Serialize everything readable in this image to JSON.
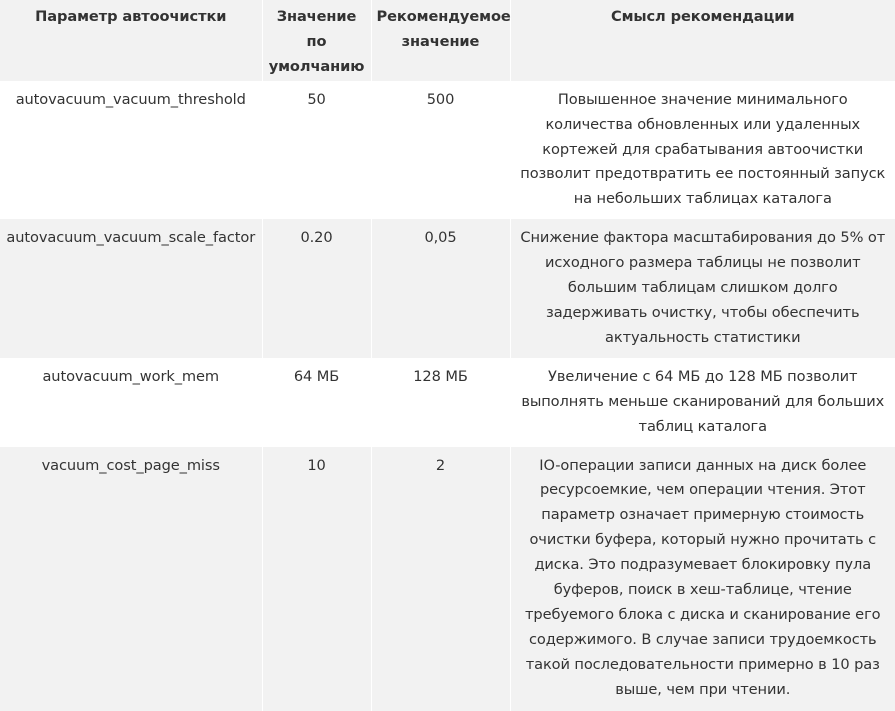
{
  "table": {
    "headers": [
      "Параметр автоочистки",
      "Значение по умолчанию",
      "Рекомендуемое значение",
      "Смысл рекомендации"
    ],
    "rows": [
      {
        "param": "autovacuum_vacuum_threshold",
        "default": "50",
        "recommended": "500",
        "meaning": "Повышенное значение минимального количества обновленных или удаленных кортежей для срабатывания автоочистки позволит предотвратить ее постоянный запуск на небольших таблицах каталога"
      },
      {
        "param": "autovacuum_vacuum_scale_factor",
        "default": "0.20",
        "recommended": "0,05",
        "meaning": "Снижение фактора масштабирования до 5% от исходного размера таблицы не позволит большим таблицам слишком долго задерживать очистку, чтобы обеспечить актуальность статистики"
      },
      {
        "param": "autovacuum_work_mem",
        "default": "64 МБ",
        "recommended": "128 МБ",
        "meaning": "Увеличение с 64 МБ до 128 МБ позволит выполнять меньше сканирований для больших таблиц каталога"
      },
      {
        "param": "vacuum_cost_page_miss",
        "default": "10",
        "recommended": "2",
        "meaning": "IO-операции записи данных на диск более ресурсоемкие, чем операции чтения. Этот параметр означает примерную стоимость очистки буфера, который нужно прочитать с диска. Это подразумевает блокировку пула буферов, поиск в хеш-таблице, чтение требуемого блока с диска и сканирование его содержимого. В случае записи трудоемкость такой последовательности примерно в 10 раз выше, чем при чтении."
      }
    ]
  }
}
